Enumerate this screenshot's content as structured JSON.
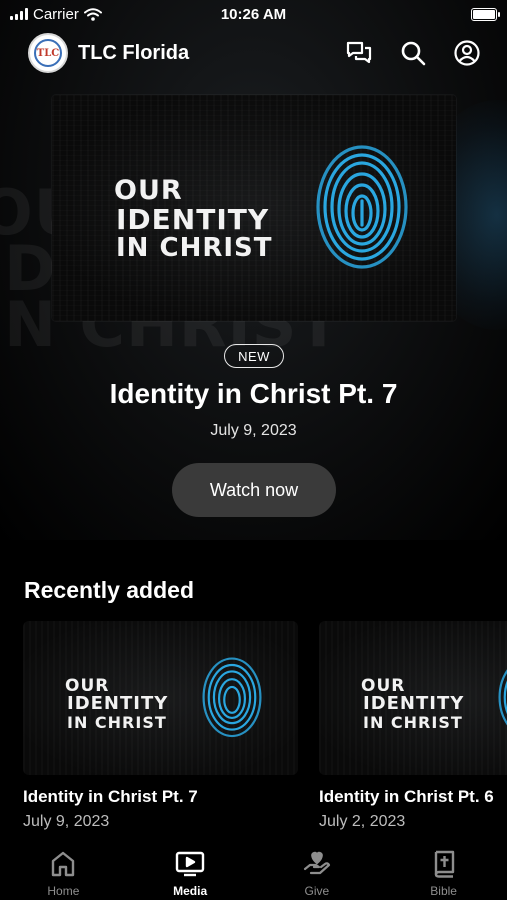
{
  "status_bar": {
    "carrier": "Carrier",
    "time": "10:26 AM"
  },
  "header": {
    "title": "TLC Florida",
    "logo_text": "TLC",
    "icons": [
      "chat-icon",
      "search-icon",
      "profile-icon"
    ]
  },
  "hero": {
    "artwork_lines": [
      "OUR",
      "IDENTITY",
      "IN CHRIST"
    ],
    "badge": "NEW",
    "title": "Identity in Christ Pt. 7",
    "date": "July 9, 2023",
    "button_label": "Watch now"
  },
  "recently_added": {
    "heading": "Recently added",
    "items": [
      {
        "artwork_lines": [
          "OUR",
          "IDENTITY",
          "IN CHRIST"
        ],
        "title": "Identity in Christ Pt. 7",
        "date": "July 9, 2023"
      },
      {
        "artwork_lines": [
          "OUR",
          "IDENTITY",
          "IN CHRIST"
        ],
        "title": "Identity in Christ Pt. 6",
        "date": "July 2, 2023"
      }
    ]
  },
  "tab_bar": {
    "tabs": [
      {
        "label": "Home",
        "icon": "home-icon",
        "active": false
      },
      {
        "label": "Media",
        "icon": "media-icon",
        "active": true
      },
      {
        "label": "Give",
        "icon": "give-icon",
        "active": false
      },
      {
        "label": "Bible",
        "icon": "bible-icon",
        "active": false
      }
    ]
  },
  "colors": {
    "background": "#000000",
    "fingerprint_blue": "#2aa7e0",
    "button_bg": "#3a3a3a",
    "inactive_tab": "#8e8e8e"
  }
}
